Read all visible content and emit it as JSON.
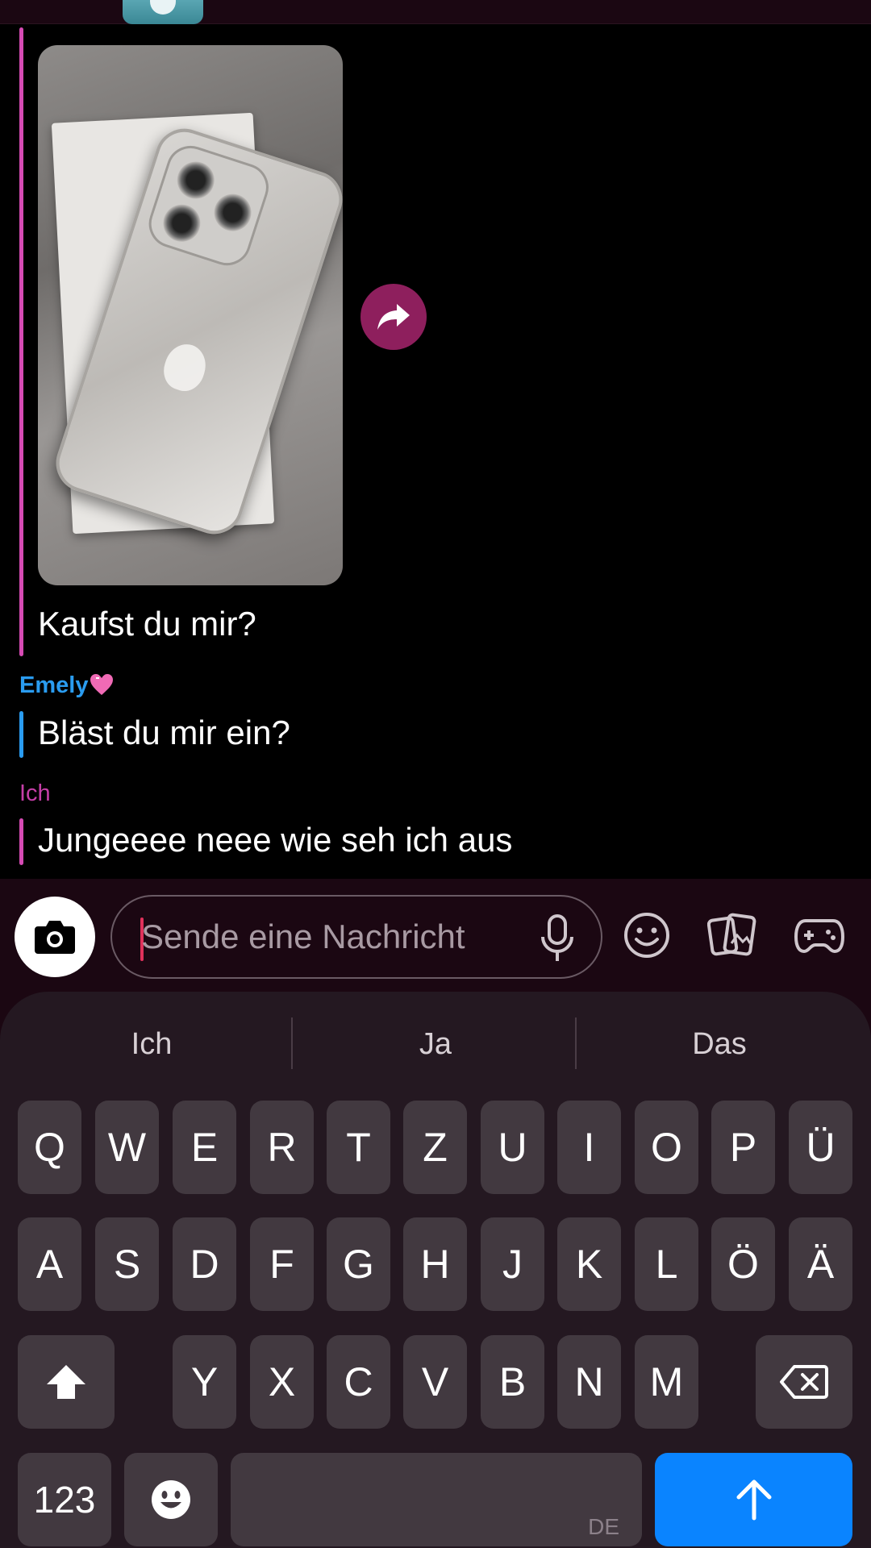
{
  "chat": {
    "messages": [
      {
        "text": "Kaufst du mir?"
      },
      {
        "sender": "Emely",
        "text": "Bläst du mir ein?"
      },
      {
        "sender": "Ich",
        "text": "Jungeeee neee wie seh ich aus"
      }
    ]
  },
  "composer": {
    "placeholder": "Sende eine Nachricht"
  },
  "keyboard": {
    "suggestions": [
      "Ich",
      "Ja",
      "Das"
    ],
    "row1": [
      "Q",
      "W",
      "E",
      "R",
      "T",
      "Z",
      "U",
      "I",
      "O",
      "P",
      "Ü"
    ],
    "row2": [
      "A",
      "S",
      "D",
      "F",
      "G",
      "H",
      "J",
      "K",
      "L",
      "Ö",
      "Ä"
    ],
    "row3": [
      "Y",
      "X",
      "C",
      "V",
      "B",
      "N",
      "M"
    ],
    "numbers_label": "123",
    "language_label": "DE"
  },
  "colors": {
    "accent_pink": "#d64bb4",
    "accent_blue": "#2a9cf0",
    "send_blue": "#0a84ff",
    "forward_button": "#8e1f5d"
  }
}
